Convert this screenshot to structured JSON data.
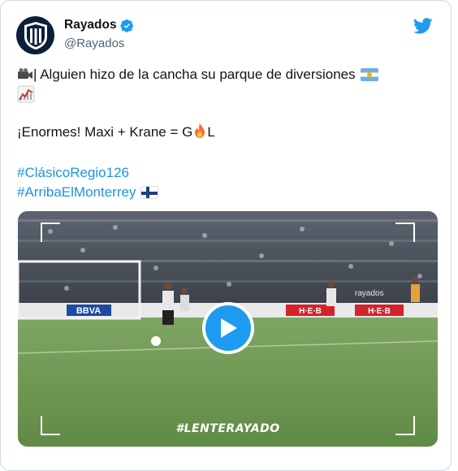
{
  "account": {
    "name": "Rayados",
    "handle": "@Rayados",
    "avatar_icon": "rayados-crest-icon",
    "verified_icon": "verified-badge-icon"
  },
  "tweet": {
    "line1_text": "| Alguien hizo de la cancha su parque de diversiones",
    "line2_prefix": "¡Enormes! Maxi + Krane = G",
    "line2_suffix": "L",
    "hashtags": [
      "#ClásicoRegio126",
      "#ArribaElMonterrey"
    ]
  },
  "media": {
    "overlay_tag": "#LENTERAYADO",
    "board_texts": [
      "BBVA",
      "H·E·B",
      "H·E·B",
      "rayados"
    ]
  },
  "colors": {
    "link": "#1b95e0",
    "brand_twitter": "#1d9bf0",
    "handle": "#536471"
  }
}
